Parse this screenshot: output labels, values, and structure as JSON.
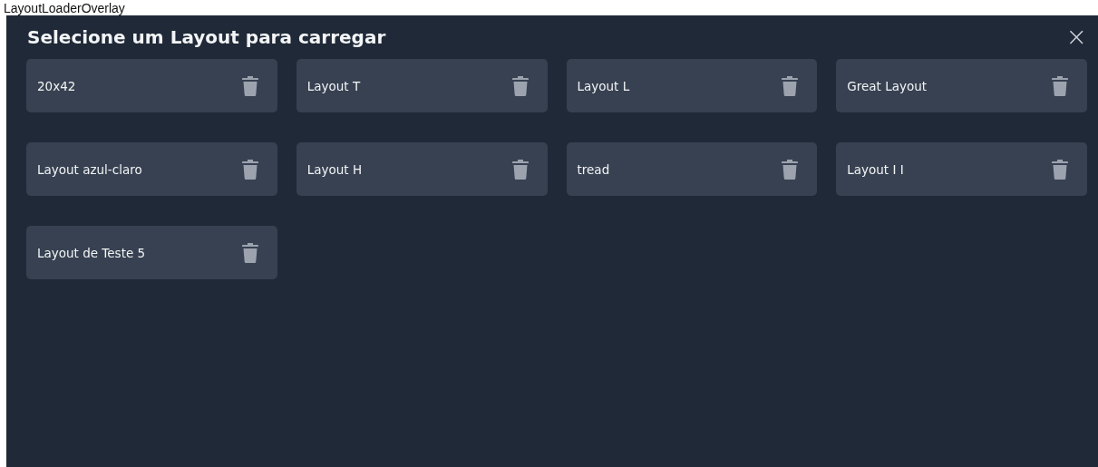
{
  "caption": "LayoutLoaderOverlay",
  "dialog": {
    "title": "Selecione um Layout para carregar",
    "close": "×"
  },
  "layouts": [
    {
      "name": "20x42"
    },
    {
      "name": "Layout T"
    },
    {
      "name": "Layout L"
    },
    {
      "name": "Great Layout"
    },
    {
      "name": "Layout azul-claro"
    },
    {
      "name": "Layout H"
    },
    {
      "name": "tread"
    },
    {
      "name": "Layout I I"
    },
    {
      "name": "Layout de Teste 5"
    }
  ]
}
